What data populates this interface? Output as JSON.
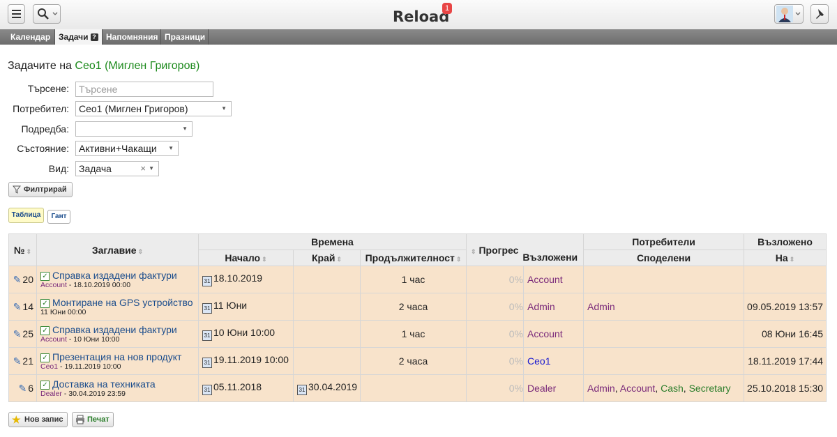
{
  "app": {
    "title": "Reload",
    "notification_count": "1"
  },
  "tabs": [
    {
      "label": "Календар"
    },
    {
      "label": "Задачи",
      "help": "?"
    },
    {
      "label": "Напомняния"
    },
    {
      "label": "Празници"
    }
  ],
  "heading": {
    "prefix": "Задачите на",
    "user": "Ceo1 (Миглен Григоров)"
  },
  "filters": {
    "search_label": "Търсене:",
    "search_placeholder": "Търсене",
    "user_label": "Потребител:",
    "user_value": "Ceo1 (Миглен Григоров)",
    "sort_label": "Подредба:",
    "sort_value": "",
    "status_label": "Състояние:",
    "status_value": "Активни+Чакащи",
    "kind_label": "Вид:",
    "kind_value": "Задача",
    "filter_button": "Филтрирай"
  },
  "views": {
    "table": "Таблица",
    "gantt": "Гант"
  },
  "table": {
    "col_no": "№",
    "col_title": "Заглавие",
    "group_times": "Времена",
    "col_start": "Начало",
    "col_end": "Край",
    "col_duration": "Продължителност",
    "col_progress": "Прогрес",
    "group_users": "Потребители",
    "col_assigned": "Възложени",
    "col_shared": "Споделени",
    "group_assigned_on": "Възложено",
    "col_on": "На",
    "rows": [
      {
        "no": "20",
        "title": "Справка издадени фактури",
        "owner": "Account",
        "sub_date": " - 18.10.2019 00:00",
        "start": "18.10.2019",
        "end": "",
        "duration": "1 час",
        "progress": "0%",
        "assigned": "Account",
        "shared": [],
        "on": ""
      },
      {
        "no": "14",
        "title": "Монтиране на GPS устройство",
        "owner": "",
        "sub_date": "11 Юни 00:00",
        "start": "11 Юни",
        "end": "",
        "duration": "2 часа",
        "progress": "0%",
        "assigned": "Admin",
        "shared": [
          "Admin"
        ],
        "on": "09.05.2019 13:57"
      },
      {
        "no": "25",
        "title": "Справка издадени фактури",
        "owner": "Account",
        "sub_date": " - 10 Юни 10:00",
        "start": "10 Юни 10:00",
        "end": "",
        "duration": "1 час",
        "progress": "0%",
        "assigned": "Account",
        "shared": [],
        "on": "08 Юни 16:45"
      },
      {
        "no": "21",
        "title": "Презентация на нов продукт",
        "owner": "Ceo1",
        "sub_date": " - 19.11.2019 10:00",
        "start": "19.11.2019 10:00",
        "end": "",
        "duration": "2 часа",
        "progress": "0%",
        "assigned": "Ceo1",
        "shared": [],
        "on": "18.11.2019 17:44"
      },
      {
        "no": "6",
        "title": "Доставка на техниката",
        "owner": "Dealer",
        "sub_date": " - 30.04.2019 23:59",
        "start": "05.11.2018",
        "end": "30.04.2019",
        "duration": "",
        "progress": "0%",
        "assigned": "Dealer",
        "shared": [
          "Admin",
          "Account",
          "Cash",
          "Secretary"
        ],
        "on": "25.10.2018 15:30"
      }
    ]
  },
  "actions": {
    "new_record": "Нов запис",
    "print": "Печат"
  },
  "icons": [
    "menu-icon",
    "search-icon",
    "avatar",
    "pin-icon",
    "pencil-icon",
    "checkbox-icon",
    "calendar-icon",
    "filter-icon",
    "star-icon",
    "printer-icon",
    "sort-icon"
  ]
}
